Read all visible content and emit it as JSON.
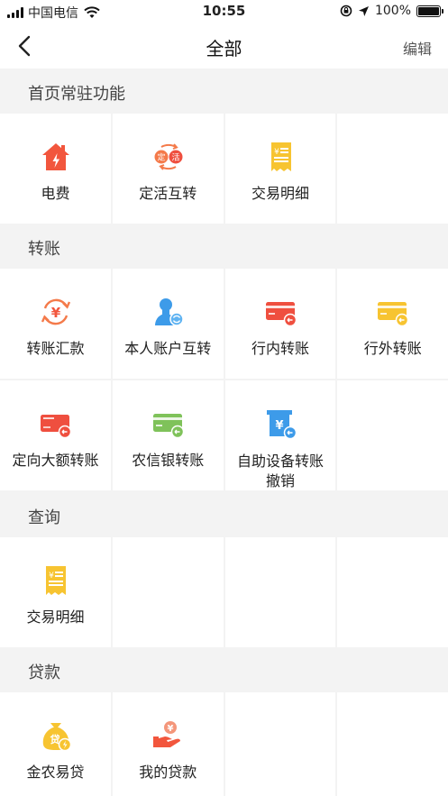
{
  "status_bar": {
    "carrier": "中国电信",
    "time": "10:55",
    "battery": "100%"
  },
  "nav": {
    "title": "全部",
    "edit_label": "编辑"
  },
  "sections": {
    "home": {
      "title": "首页常驻功能",
      "items": [
        {
          "label": "电费",
          "icon": "electricity-icon"
        },
        {
          "label": "定活互转",
          "icon": "fixed-demand-transfer-icon",
          "icon_text_1": "定",
          "icon_text_2": "活"
        },
        {
          "label": "交易明细",
          "icon": "receipt-icon"
        }
      ]
    },
    "transfer": {
      "title": "转账",
      "items": [
        {
          "label": "转账汇款",
          "icon": "yen-exchange-icon"
        },
        {
          "label": "本人账户互转",
          "icon": "person-transfer-icon"
        },
        {
          "label": "行内转账",
          "icon": "red-card-icon"
        },
        {
          "label": "行外转账",
          "icon": "yellow-card-icon"
        },
        {
          "label": "定向大额转账",
          "icon": "red-large-card-icon"
        },
        {
          "label": "农信银转账",
          "icon": "green-card-icon"
        },
        {
          "label_line1": "自助设备转账",
          "label_line2": "撤销",
          "icon": "atm-icon"
        }
      ]
    },
    "query": {
      "title": "查询",
      "items": [
        {
          "label": "交易明细",
          "icon": "receipt-icon"
        }
      ]
    },
    "loan": {
      "title": "贷款",
      "items": [
        {
          "label": "金农易贷",
          "icon": "money-bag-icon",
          "icon_text": "贷"
        },
        {
          "label": "我的贷款",
          "icon": "hand-coin-icon"
        }
      ]
    }
  },
  "colors": {
    "orange": "#f47a4a",
    "red": "#ef4f3f",
    "yellow": "#f7c431",
    "blue": "#3d9be9",
    "green": "#7fc25a",
    "bg": "#f3f3f3"
  }
}
